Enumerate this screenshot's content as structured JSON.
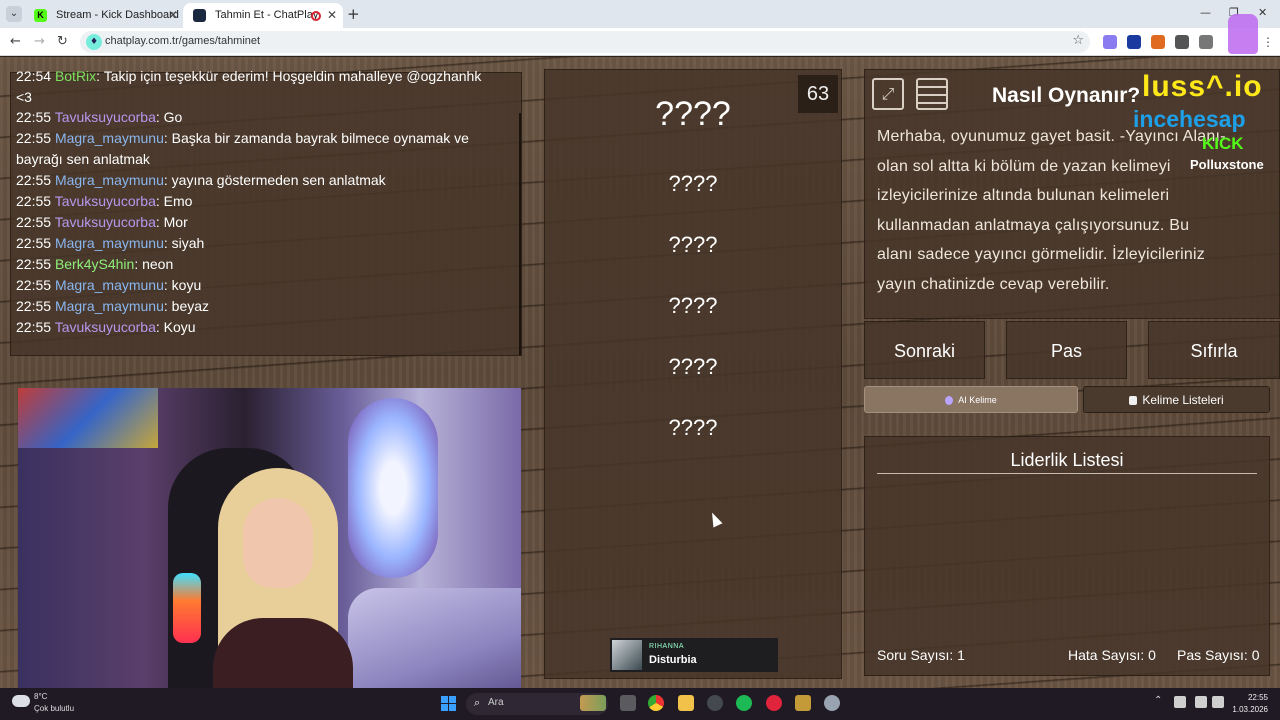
{
  "browser": {
    "tabs": [
      {
        "title": "Stream - Kick Dashboard",
        "icon": "kick-icon"
      },
      {
        "title": "Tahmin Et - ChatPlay",
        "icon": "chatplay-icon"
      }
    ],
    "url": "chatplay.com.tr/games/tahminet",
    "kick_icon_letter": "K"
  },
  "chat": {
    "lines": [
      {
        "time": "22:54",
        "user": "BotRix",
        "color": "green",
        "msg": ": Takip için teşekkür ederim! Hoşgeldin mahalleye @ogzhanhk <3"
      },
      {
        "time": "22:55",
        "user": "Tavuksuyucorba",
        "color": "violet",
        "msg": ": Go"
      },
      {
        "time": "22:55",
        "user": "Magra_maymunu",
        "color": "blue",
        "msg": ": Başka bir zamanda bayrak bilmece oynamak ve bayrağı sen anlatmak"
      },
      {
        "time": "22:55",
        "user": "Magra_maymunu",
        "color": "blue",
        "msg": ": yayına göstermeden sen anlatmak"
      },
      {
        "time": "22:55",
        "user": "Tavuksuyucorba",
        "color": "violet",
        "msg": ": Emo"
      },
      {
        "time": "22:55",
        "user": "Tavuksuyucorba",
        "color": "violet",
        "msg": ": Mor"
      },
      {
        "time": "22:55",
        "user": "Magra_maymunu",
        "color": "blue",
        "msg": ": siyah"
      },
      {
        "time": "22:55",
        "user": "Berk4yS4hin",
        "color": "lime",
        "msg": ": neon"
      },
      {
        "time": "22:55",
        "user": "Magra_maymunu",
        "color": "blue",
        "msg": ": koyu"
      },
      {
        "time": "22:55",
        "user": "Magra_maymunu",
        "color": "blue",
        "msg": ": beyaz"
      },
      {
        "time": "22:55",
        "user": "Tavuksuyucorba",
        "color": "violet",
        "msg": ": Koyu"
      }
    ]
  },
  "game": {
    "timer": "63",
    "main_word": "????",
    "forbidden_words": [
      "????",
      "????",
      "????",
      "????",
      "????"
    ],
    "howto_title": "Nasıl Oynanır?",
    "howto_text": "Merhaba, oyunumuz gayet basit. -Yayıncı Alanı- olan sol altta ki bölüm de yazan kelimeyi izleyicilerinize altında bulunan kelimeleri kullanmadan anlatmaya çalışıyorsunuz. Bu alanı sadece yayıncı görmelidir. İzleyicileriniz yayın chatinizde cevap verebilir.",
    "buttons": {
      "next": "Sonraki",
      "pass": "Pas",
      "reset": "Sıfırla",
      "ai_word": "AI Kelime",
      "word_lists": "Kelime Listeleri"
    },
    "leaderboard_title": "Liderlik Listesi",
    "stats": {
      "questions_label": "Soru Sayısı:",
      "questions": "1",
      "errors_label": "Hata Sayısı:",
      "errors": "0",
      "passes_label": "Pas Sayısı:",
      "passes": "0"
    }
  },
  "now_playing": {
    "artist": "RIHANNA",
    "title": "Disturbia"
  },
  "overlay": {
    "brand": "luss^.io",
    "site": "incehesap",
    "platform": "KICK",
    "username": "Polluxstone"
  },
  "taskbar": {
    "weather_temp": "8°C",
    "weather_desc": "Çok bulutlu",
    "search_placeholder": "Ara",
    "clock_time": "22:55",
    "clock_date": "1.03.2026"
  },
  "colors": {
    "kick_green": "#53fc18",
    "user_green": "#7fe060",
    "user_violet": "#b598ee",
    "user_blue": "#8ab6f0",
    "user_lime": "#8ff07a",
    "brand_yellow": "#ffe81a",
    "site_blue": "#1ea0e8"
  }
}
